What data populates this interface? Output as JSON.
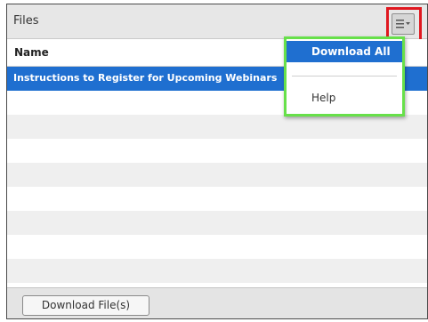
{
  "panel": {
    "title": "Files",
    "column_header": "Name",
    "rows": [
      {
        "name": "Instructions to Register for Upcoming Webinars",
        "selected": true
      },
      {
        "name": ""
      },
      {
        "name": ""
      },
      {
        "name": ""
      },
      {
        "name": ""
      },
      {
        "name": ""
      },
      {
        "name": ""
      },
      {
        "name": ""
      },
      {
        "name": ""
      }
    ],
    "download_button": "Download File(s)"
  },
  "menu": {
    "button_icon": "list-menu-icon",
    "items": [
      {
        "label": "Download All",
        "highlighted": true
      },
      {
        "label": "Help"
      }
    ]
  },
  "colors": {
    "selection": "#1f6fd0",
    "menu_button_highlight": "#e01820",
    "dropdown_highlight": "#67e04a"
  }
}
